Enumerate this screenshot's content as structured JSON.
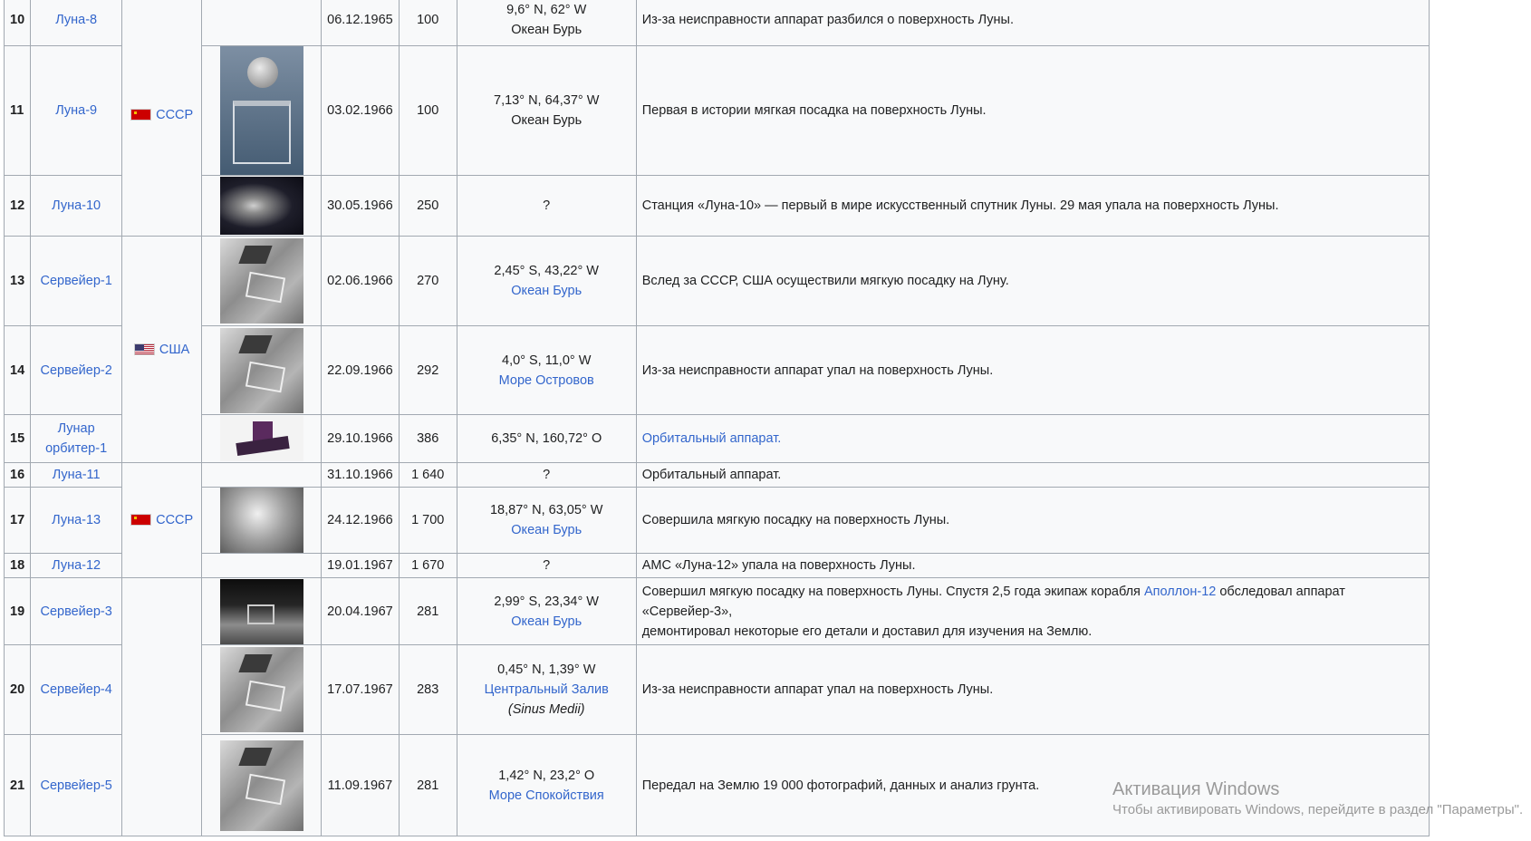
{
  "rows": [
    {
      "num": "10",
      "name": "Луна-8",
      "date": "06.12.1965",
      "mass": "100",
      "coords": "9,6° N, 62° W",
      "place": "Океан Бурь",
      "desc": "Из-за неисправности аппарат разбился о поверхность Луны."
    },
    {
      "num": "11",
      "name": "Луна-9",
      "date": "03.02.1966",
      "mass": "100",
      "coords": "7,13° N, 64,37° W",
      "place": "Океан Бурь",
      "desc": "Первая в истории мягкая посадка на поверхность Луны."
    },
    {
      "num": "12",
      "name": "Луна-10",
      "date": "30.05.1966",
      "mass": "250",
      "coords": "?",
      "desc": "Станция «Луна-10» — первый в мире искусственный спутник Луны. 29 мая упала на поверхность Луны."
    },
    {
      "num": "13",
      "name": "Сервейер-1",
      "date": "02.06.1966",
      "mass": "270",
      "coords": "2,45° S, 43,22° W",
      "place": "Океан Бурь",
      "desc": "Вслед за СССР, США осуществили мягкую посадку на Луну."
    },
    {
      "num": "14",
      "name": "Сервейер-2",
      "date": "22.09.1966",
      "mass": "292",
      "coords": "4,0° S, 11,0° W",
      "place": "Море Островов",
      "desc": "Из-за неисправности аппарат упал на поверхность Луны."
    },
    {
      "num": "15",
      "name_line1": "Лунар",
      "name_line2": "орбитер-1",
      "date": "29.10.1966",
      "mass": "386",
      "coords": "6,35° N, 160,72° O",
      "desc": "Орбитальный аппарат."
    },
    {
      "num": "16",
      "name": "Луна-11",
      "date": "31.10.1966",
      "mass": "1 640",
      "coords": "?",
      "desc": "Орбитальный аппарат."
    },
    {
      "num": "17",
      "name": "Луна-13",
      "date": "24.12.1966",
      "mass": "1 700",
      "coords": "18,87° N, 63,05° W",
      "place": "Океан Бурь",
      "desc": "Совершила мягкую посадку на поверхность Луны."
    },
    {
      "num": "18",
      "name": "Луна-12",
      "date": "19.01.1967",
      "mass": "1 670",
      "coords": "?",
      "desc": "АМС «Луна-12» упала на поверхность Луны."
    },
    {
      "num": "19",
      "name": "Сервейер-3",
      "date": "20.04.1967",
      "mass": "281",
      "coords": "2,99° S, 23,34° W",
      "place": "Океан Бурь",
      "desc_part1": "Совершил мягкую посадку на поверхность Луны. Спустя 2,5 года экипаж корабля ",
      "desc_link": "Аполлон-12",
      "desc_part2": " обследовал аппарат «Сервейер-3»,",
      "desc_line2": "демонтировал некоторые его детали и доставил для изучения на Землю."
    },
    {
      "num": "20",
      "name": "Сервейер-4",
      "date": "17.07.1967",
      "mass": "283",
      "coords": "0,45° N, 1,39° W",
      "place": "Центральный Залив",
      "place_latin": "(Sinus Medii)",
      "desc": "Из-за неисправности аппарат упал на поверхность Луны."
    },
    {
      "num": "21",
      "name": "Сервейер-5",
      "date": "11.09.1967",
      "mass": "281",
      "coords": "1,42° N, 23,2° O",
      "place": "Море Спокойствия",
      "desc": "Передал на Землю 19 000 фотографий, данных и анализ грунта."
    }
  ],
  "countries": {
    "ussr": "СССР",
    "usa": "США"
  },
  "watermark": {
    "title": "Активация Windows",
    "subtitle": "Чтобы активировать Windows, перейдите в раздел \"Параметры\"."
  },
  "colors": {
    "link": "#3366cc",
    "table_bg": "#f8f9fa",
    "border": "#a2a9b1"
  },
  "icons": [
    "flag-ussr-icon",
    "flag-usa-icon"
  ]
}
